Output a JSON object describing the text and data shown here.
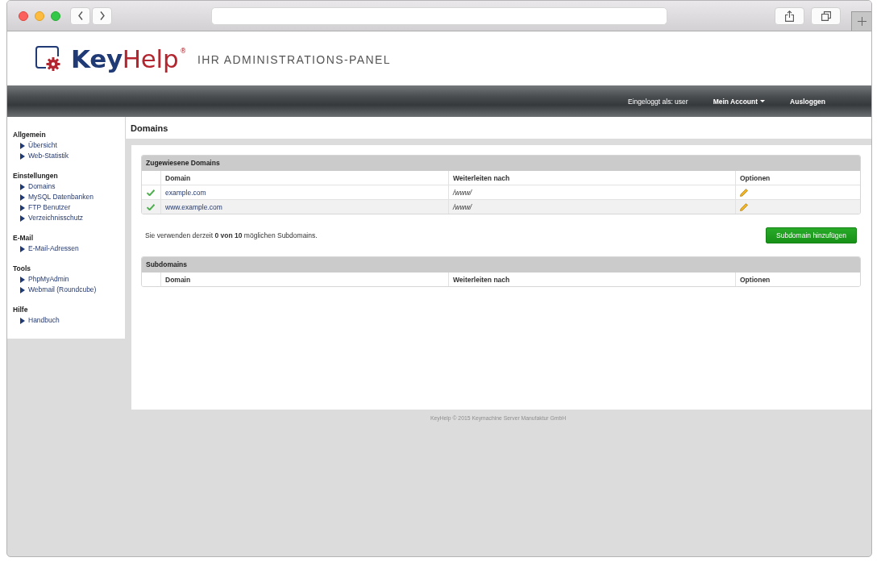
{
  "logo": {
    "parts": [
      "Key",
      "Help"
    ],
    "mark": "®"
  },
  "tagline": "IHR ADMINISTRATIONS-PANEL",
  "navbar": {
    "user": "Eingeloggt als: user",
    "account_menu": "Mein Account",
    "logout": "Ausloggen"
  },
  "sidebar": {
    "sections": [
      {
        "title": "Allgemein",
        "items": [
          "Übersicht",
          "Web-Statistik"
        ]
      },
      {
        "title": "Einstellungen",
        "items": [
          "Domains",
          "MySQL Datenbanken",
          "FTP Benutzer",
          "Verzeichnisschutz"
        ]
      },
      {
        "title": "E-Mail",
        "items": [
          "E-Mail-Adressen"
        ]
      },
      {
        "title": "Tools",
        "items": [
          "PhpMyAdmin",
          "Webmail (Roundcube)"
        ]
      },
      {
        "title": "Hilfe",
        "items": [
          "Handbuch"
        ]
      }
    ]
  },
  "page_title": "Domains",
  "domains_table": {
    "title": "Zugewiesene Domains",
    "columns": [
      "Domain",
      "Weiterleiten nach",
      "Optionen"
    ],
    "rows": [
      {
        "active": true,
        "domain": "example.com",
        "redirect": "/www/"
      },
      {
        "active": true,
        "domain": "www.example.com",
        "redirect": "/www/"
      }
    ]
  },
  "usage_note": "Sie verwenden derzeit **0 von 10** möglichen Subdomains.",
  "add_button": "Subdomain hinzufügen",
  "subdomains_table": {
    "title": "Subdomains",
    "columns": [
      "Domain",
      "Weiterleiten nach",
      "Optionen"
    ]
  },
  "footer": "KeyHelp © 2015 Keymachine Server Manufaktur GmbH"
}
